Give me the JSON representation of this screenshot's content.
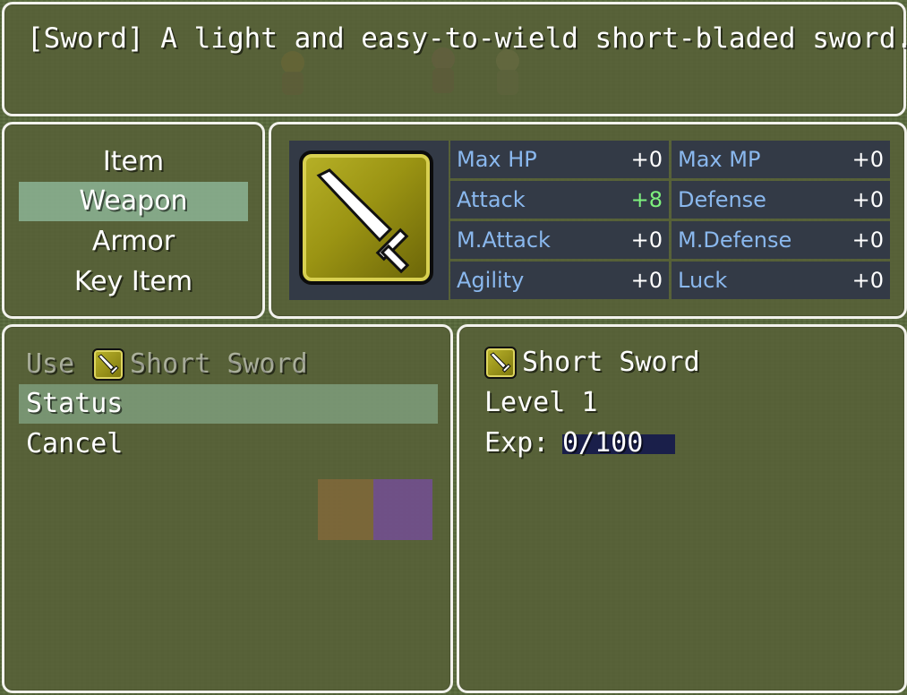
{
  "help": {
    "text": "[Sword] A light and easy-to-wield short-bladed sword."
  },
  "categories": [
    {
      "label": "Item",
      "selected": false
    },
    {
      "label": "Weapon",
      "selected": true
    },
    {
      "label": "Armor",
      "selected": false
    },
    {
      "label": "Key Item",
      "selected": false
    }
  ],
  "item_icon": "sword-icon",
  "stats": [
    {
      "label": "Max HP",
      "value": "+0"
    },
    {
      "label": "Max MP",
      "value": "+0"
    },
    {
      "label": "Attack",
      "value": "+8"
    },
    {
      "label": "Defense",
      "value": "+0"
    },
    {
      "label": "M.Attack",
      "value": "+0"
    },
    {
      "label": "M.Defense",
      "value": "+0"
    },
    {
      "label": "Agility",
      "value": "+0"
    },
    {
      "label": "Luck",
      "value": "+0"
    }
  ],
  "colors": {
    "stat_label": "#8ab8ee",
    "stat_increase": "#7df07d",
    "selection": "#a9d9c0",
    "window_border": "#f2f2ec"
  },
  "commands": {
    "use_label": "Use",
    "use_item": "Short Sword",
    "status_label": "Status",
    "cancel_label": "Cancel"
  },
  "detail": {
    "item_name": "Short Sword",
    "level": "Level 1",
    "exp_label": "Exp:",
    "exp_value": "0/100",
    "exp_progress": 0
  }
}
